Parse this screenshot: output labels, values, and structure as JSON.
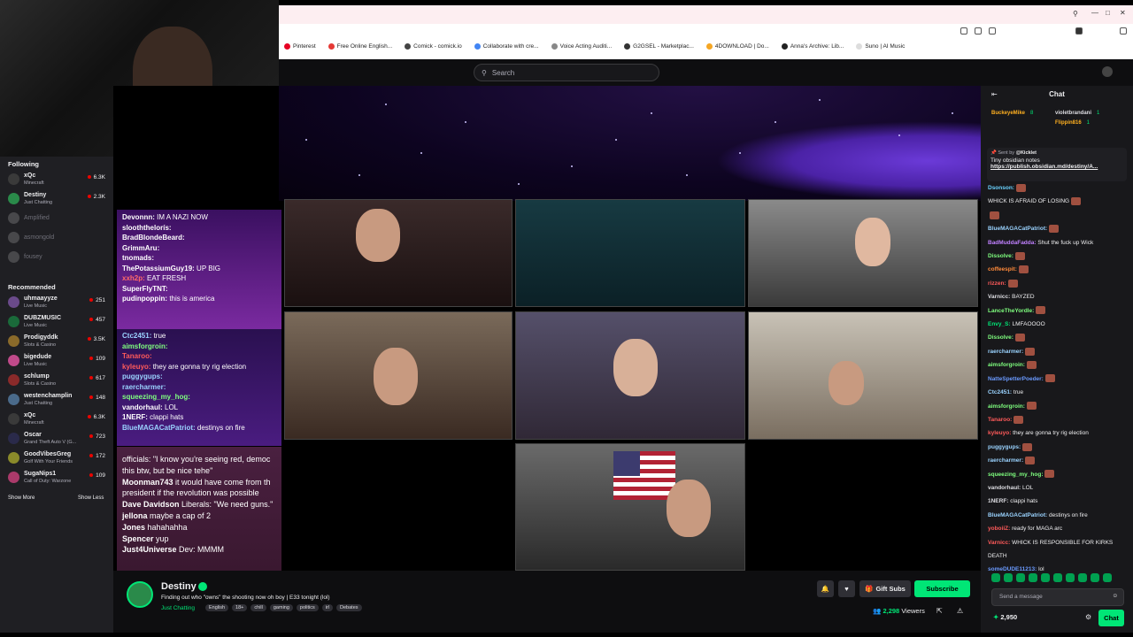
{
  "browser": {
    "bookmarks": [
      {
        "label": "Pinterest",
        "color": "#e60023"
      },
      {
        "label": "Free Online English...",
        "color": "#e53935"
      },
      {
        "label": "Comick - comick.io",
        "color": "#444"
      },
      {
        "label": "Collaborate with cre...",
        "color": "#4285f4"
      },
      {
        "label": "Voice Acting Auditi...",
        "color": "#888"
      },
      {
        "label": "G2GSEL - Marketplac...",
        "color": "#333"
      },
      {
        "label": "4DOWNLOAD | Do...",
        "color": "#f5a623"
      },
      {
        "label": "Anna's Archive: Lib...",
        "color": "#222"
      },
      {
        "label": "Suno | AI Music",
        "color": "#ddd"
      }
    ]
  },
  "search": {
    "placeholder": "Search"
  },
  "sidebar": {
    "following_title": "Following",
    "following": [
      {
        "name": "xQc",
        "game": "Minecraft",
        "viewers": "6.3K",
        "color": "#3a3a3a",
        "online": true
      },
      {
        "name": "Destiny",
        "game": "Just Chatting",
        "viewers": "2.3K",
        "color": "#2a8a4a",
        "online": true
      },
      {
        "name": "Amplified",
        "game": "",
        "viewers": "",
        "color": "#888",
        "online": false
      },
      {
        "name": "asmongold",
        "game": "",
        "viewers": "",
        "color": "#888",
        "online": false
      },
      {
        "name": "fousey",
        "game": "",
        "viewers": "",
        "color": "#888",
        "online": false
      }
    ],
    "recommended_title": "Recommended",
    "recommended": [
      {
        "name": "uhmaayyze",
        "game": "Live Music",
        "viewers": "251",
        "color": "#6a4a8a"
      },
      {
        "name": "DUBZMUSIC",
        "game": "Live Music",
        "viewers": "457",
        "color": "#1a6a3a"
      },
      {
        "name": "Prodigyddk",
        "game": "Slots & Casino",
        "viewers": "3.5K",
        "color": "#8a6a2a"
      },
      {
        "name": "bigedude",
        "game": "Live Music",
        "viewers": "109",
        "color": "#c04a8a"
      },
      {
        "name": "schlump",
        "game": "Slots & Casino",
        "viewers": "617",
        "color": "#8a2a2a"
      },
      {
        "name": "westenchamplin",
        "game": "Just Chatting",
        "viewers": "148",
        "color": "#4a6a8a"
      },
      {
        "name": "xQc",
        "game": "Minecraft",
        "viewers": "6.3K",
        "color": "#3a3a3a"
      },
      {
        "name": "Oscar",
        "game": "Grand Theft Auto V (G...",
        "viewers": "723",
        "color": "#2a2a4a"
      },
      {
        "name": "GoodVibesGreg",
        "game": "Golf With Your Friends",
        "viewers": "172",
        "color": "#8a8a2a"
      },
      {
        "name": "SugaNips1",
        "game": "Call of Duty: Warzone",
        "viewers": "109",
        "color": "#aa3a6a"
      }
    ],
    "show_more": "Show More",
    "show_less": "Show Less"
  },
  "overlay_chat_1": [
    {
      "user": "Devonnn:",
      "msg": " IM A NAZI NOW",
      "color": "#ffffff"
    },
    {
      "user": "slooththelorís:",
      "msg": "",
      "color": "#ffffff"
    },
    {
      "user": "BradBlondeBeard:",
      "msg": "",
      "color": "#ffffff"
    },
    {
      "user": "GrimmAru:",
      "msg": "",
      "color": "#ffffff"
    },
    {
      "user": "tnomads:",
      "msg": "",
      "color": "#ffffff"
    },
    {
      "user": "ThePotassiumGuy19:",
      "msg": " UP BIG",
      "color": "#ffffff"
    },
    {
      "user": "xxh2p:",
      "msg": " EAT FRESH",
      "color": "#ff6a6a"
    },
    {
      "user": "SuperFlyTNT:",
      "msg": "",
      "color": "#ffffff"
    },
    {
      "user": "pudinpoppin:",
      "msg": " this is america",
      "color": "#ffffff"
    }
  ],
  "overlay_chat_2": [
    {
      "user": "Ctc2451:",
      "msg": " true",
      "color": "#9ad3ff"
    },
    {
      "user": "aimsforgroin:",
      "msg": "",
      "color": "#7fff7f"
    },
    {
      "user": "Tanaroo:",
      "msg": "",
      "color": "#ff5a5a"
    },
    {
      "user": "kyleuyo:",
      "msg": " they are gonna try rig election",
      "color": "#ff5a5a"
    },
    {
      "user": "puggygups:",
      "msg": "",
      "color": "#9ad3ff"
    },
    {
      "user": "raercharmer:",
      "msg": "",
      "color": "#9ad3ff"
    },
    {
      "user": "squeezing_my_hog:",
      "msg": "",
      "color": "#7fff7f"
    },
    {
      "user": "vandorhaul:",
      "msg": " LOL",
      "color": "#ffffff"
    },
    {
      "user": "1NERF:",
      "msg": " clappi hats",
      "color": "#ffffff"
    },
    {
      "user": "BlueMAGACatPatriot:",
      "msg": " destinys on fire",
      "color": "#9ad3ff"
    }
  ],
  "overlay_chat_3": [
    {
      "user": "",
      "msg": "officials: \"I know you're seeing red, democ"
    },
    {
      "user": "",
      "msg": "this btw, but be nice tehe\""
    },
    {
      "user": "Moonman743",
      "msg": " it would have come from th"
    },
    {
      "user": "",
      "msg": "president if the revolution was possible"
    },
    {
      "user": "Dave Davidson",
      "msg": " Liberals: \"We need guns.\""
    },
    {
      "user": "jellona",
      "msg": " maybe a cap of 2"
    },
    {
      "user": "Jones",
      "msg": " hahahahha"
    },
    {
      "user": "Spencer",
      "msg": " yup"
    },
    {
      "user": "Just4Universe",
      "msg": " Dev: MMMM"
    }
  ],
  "stream_info": {
    "channel_name": "Destiny",
    "title": "Finding out who \"owns\" the shooting now oh boy | E33 tonight (lol)",
    "category": "Just Chatting",
    "tags": [
      "English",
      "18+",
      "chill",
      "gaming",
      "politics",
      "irl",
      "Debates"
    ],
    "gift_subs": "Gift Subs",
    "subscribe": "Subscribe",
    "viewer_count": "2,298",
    "viewers_label": "Viewers"
  },
  "chat": {
    "title": "Chat",
    "leaders": [
      {
        "name": "BuckeyeMike",
        "count": "8"
      },
      {
        "name": "violetbrandani",
        "count": "1"
      },
      {
        "name": "Flippin816",
        "count": "1"
      }
    ],
    "pinned": {
      "sent_by": "Sent by",
      "sender": "@Kicklet",
      "title": "Tiny obsidian notes",
      "link": "https://publish.obsidian.md/destiny/A..."
    },
    "messages": [
      {
        "user": "Dsonson:",
        "msg": "",
        "color": "#6ad3ff",
        "emote": true
      },
      {
        "user": "",
        "msg": "WHICK IS AFRAID OF LOSING",
        "color": "#ffffff",
        "emote": true
      },
      {
        "user": "",
        "msg": "",
        "color": "#ffffff",
        "emote": true
      },
      {
        "user": "BlueMAGACatPatriot:",
        "msg": "",
        "color": "#9ad3ff",
        "emote": true
      },
      {
        "user": "BadMuddaFadda:",
        "msg": " Shut the fuck up Wick",
        "color": "#c080ff",
        "emote": false
      },
      {
        "user": "Dissolve:",
        "msg": "",
        "color": "#7fff7f",
        "emote": true
      },
      {
        "user": "coffeespit:",
        "msg": "",
        "color": "#ff8a3a",
        "emote": true
      },
      {
        "user": "rizzen:",
        "msg": "",
        "color": "#ff5a5a",
        "emote": true
      },
      {
        "user": "Varnicc:",
        "msg": " BAYZED",
        "color": "#dedee3",
        "emote": false
      },
      {
        "user": "LanceTheYordle:",
        "msg": "",
        "color": "#7fff7f",
        "emote": true
      },
      {
        "user": "Envy_S:",
        "msg": " LMFAOOOO",
        "color": "#00e676",
        "emote": false
      },
      {
        "user": "Dissolve:",
        "msg": "",
        "color": "#7fff7f",
        "emote": true
      },
      {
        "user": "raercharmer:",
        "msg": "",
        "color": "#9ad3ff",
        "emote": true
      },
      {
        "user": "aimsforgroin:",
        "msg": "",
        "color": "#7fff7f",
        "emote": true
      },
      {
        "user": "NatteSpetterPoeder:",
        "msg": "",
        "color": "#6a9aff",
        "emote": true
      },
      {
        "user": "Ctc2451:",
        "msg": " true",
        "color": "#9ad3ff",
        "emote": false
      },
      {
        "user": "aimsforgroin:",
        "msg": "",
        "color": "#7fff7f",
        "emote": true
      },
      {
        "user": "Tanaroo:",
        "msg": "",
        "color": "#ff5a5a",
        "emote": true
      },
      {
        "user": "kyleuyo:",
        "msg": " they are gonna try rig election",
        "color": "#ff5a5a",
        "emote": false
      },
      {
        "user": "puggygups:",
        "msg": "",
        "color": "#9ad3ff",
        "emote": true
      },
      {
        "user": "raercharmer:",
        "msg": "",
        "color": "#9ad3ff",
        "emote": true
      },
      {
        "user": "squeezing_my_hog:",
        "msg": "",
        "color": "#7fff7f",
        "emote": true
      },
      {
        "user": "vandorhaul:",
        "msg": " LOL",
        "color": "#dedee3",
        "emote": false
      },
      {
        "user": "1NERF:",
        "msg": " clappi hats",
        "color": "#dedee3",
        "emote": false
      },
      {
        "user": "BlueMAGACatPatriot:",
        "msg": " destinys on fire",
        "color": "#9ad3ff",
        "emote": false
      },
      {
        "user": "yoboiiZ:",
        "msg": " ready for MAGA arc",
        "color": "#ff5a5a",
        "emote": false
      },
      {
        "user": "Varnicc:",
        "msg": " WHICK IS RESPONSIBLE FOR KIRKS",
        "color": "#ff5a5a",
        "emote": false
      },
      {
        "user": "",
        "msg": "DEATH",
        "color": "#dedee3",
        "emote": false
      },
      {
        "user": "someDUDE11213:",
        "msg": " lol",
        "color": "#6a9aff",
        "emote": false
      }
    ],
    "input_placeholder": "Send a message",
    "points": "2,950",
    "send_label": "Chat"
  },
  "colors": {
    "accent": "#00e676",
    "bg": "#0e0e10",
    "panel": "#18181b"
  }
}
